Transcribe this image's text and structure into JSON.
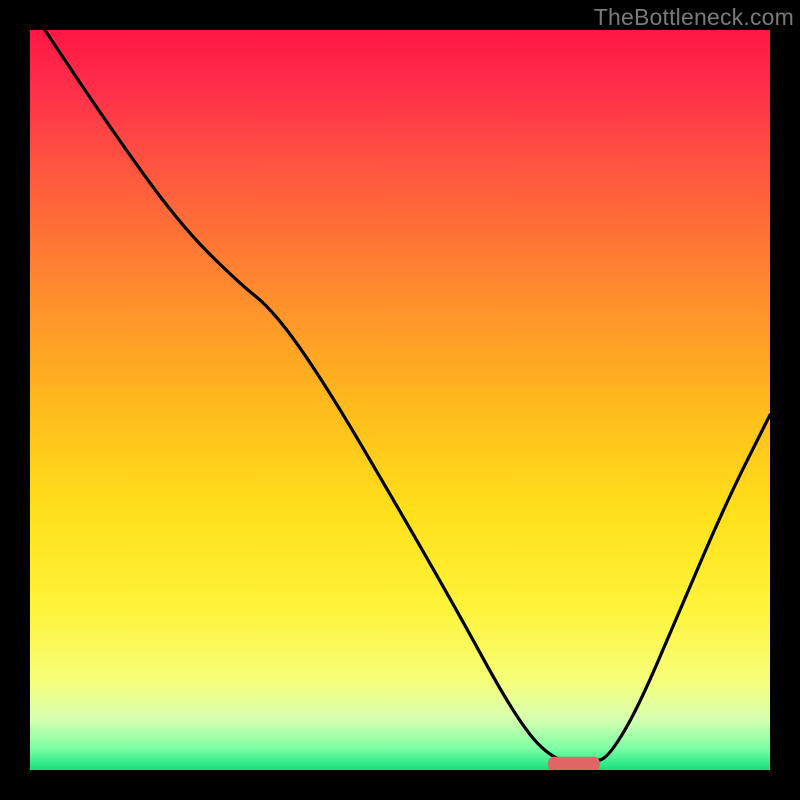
{
  "watermark": "TheBottleneck.com",
  "chart_data": {
    "type": "line",
    "title": "",
    "xlabel": "",
    "ylabel": "",
    "xlim": [
      0,
      100
    ],
    "ylim": [
      0,
      100
    ],
    "grid": false,
    "legend": false,
    "background_gradient": {
      "type": "vertical",
      "stops": [
        {
          "pos": 0.0,
          "color": "#ff1744"
        },
        {
          "pos": 0.08,
          "color": "#ff2f4a"
        },
        {
          "pos": 0.2,
          "color": "#ff5a3e"
        },
        {
          "pos": 0.35,
          "color": "#ff8a2e"
        },
        {
          "pos": 0.5,
          "color": "#ffb81d"
        },
        {
          "pos": 0.65,
          "color": "#ffe01a"
        },
        {
          "pos": 0.78,
          "color": "#fff33a"
        },
        {
          "pos": 0.88,
          "color": "#f6ff7a"
        },
        {
          "pos": 0.93,
          "color": "#d8ffb0"
        },
        {
          "pos": 0.97,
          "color": "#7fffa6"
        },
        {
          "pos": 1.0,
          "color": "#14e07a"
        }
      ]
    },
    "series": [
      {
        "name": "bottleneck-curve",
        "color": "#000000",
        "points": [
          {
            "x": 2,
            "y": 100
          },
          {
            "x": 10,
            "y": 88
          },
          {
            "x": 20,
            "y": 74
          },
          {
            "x": 28,
            "y": 66
          },
          {
            "x": 33,
            "y": 62
          },
          {
            "x": 40,
            "y": 52
          },
          {
            "x": 50,
            "y": 35
          },
          {
            "x": 58,
            "y": 21
          },
          {
            "x": 64,
            "y": 10
          },
          {
            "x": 68,
            "y": 4
          },
          {
            "x": 71,
            "y": 1.5
          },
          {
            "x": 73,
            "y": 1.2
          },
          {
            "x": 76,
            "y": 1.2
          },
          {
            "x": 78,
            "y": 1.5
          },
          {
            "x": 82,
            "y": 8
          },
          {
            "x": 88,
            "y": 22
          },
          {
            "x": 94,
            "y": 36
          },
          {
            "x": 100,
            "y": 48
          }
        ]
      }
    ],
    "marker": {
      "name": "optimal-range",
      "shape": "rounded-bar",
      "color": "#e06666",
      "x_center": 73.5,
      "y": 0.8,
      "width": 7,
      "height": 2
    }
  }
}
